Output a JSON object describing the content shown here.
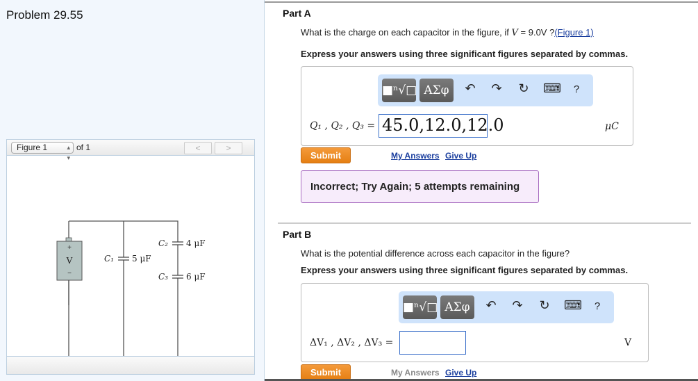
{
  "problem_title": "Problem 29.55",
  "figure_panel": {
    "select_value": "Figure 1",
    "of_label": "of 1",
    "prev_icon": "chevron-left",
    "next_icon": "chevron-right",
    "circuit": {
      "battery_plus": "+",
      "battery_label": "V",
      "battery_minus": "−",
      "c1": "C₁",
      "c1_value": "5 μF",
      "c2": "C₂",
      "c2_value": "4 μF",
      "c3": "C₃",
      "c3_value": "6 μF"
    }
  },
  "toolbar": {
    "templates": "■ⁿ√□",
    "greek": "ΑΣφ",
    "undo": "↶",
    "redo": "↷",
    "reset": "↻",
    "keyboard": "⌨",
    "help": "?"
  },
  "part_a": {
    "title": "Part A",
    "question_prefix": "What is the charge on each capacitor in the figure, if ",
    "var": "V",
    "question_mid": " = 9.0V ?",
    "figure_link": "(Figure 1)",
    "instructions": "Express your answers using three significant figures separated by commas.",
    "label": "Q₁ , Q₂ , Q₃ =",
    "value": "45.0,12.0,12.0",
    "unit": "μC",
    "submit": "Submit",
    "my_answers": "My Answers",
    "give_up": "Give Up",
    "feedback": "Incorrect; Try Again; 5 attempts remaining"
  },
  "part_b": {
    "title": "Part B",
    "question": "What is the potential difference across each capacitor in the figure?",
    "instructions": "Express your answers using three significant figures separated by commas.",
    "label": "ΔV₁ , ΔV₂ , ΔV₃ =",
    "value": "",
    "unit": "V",
    "submit": "Submit",
    "my_answers": "My Answers",
    "give_up": "Give Up"
  }
}
